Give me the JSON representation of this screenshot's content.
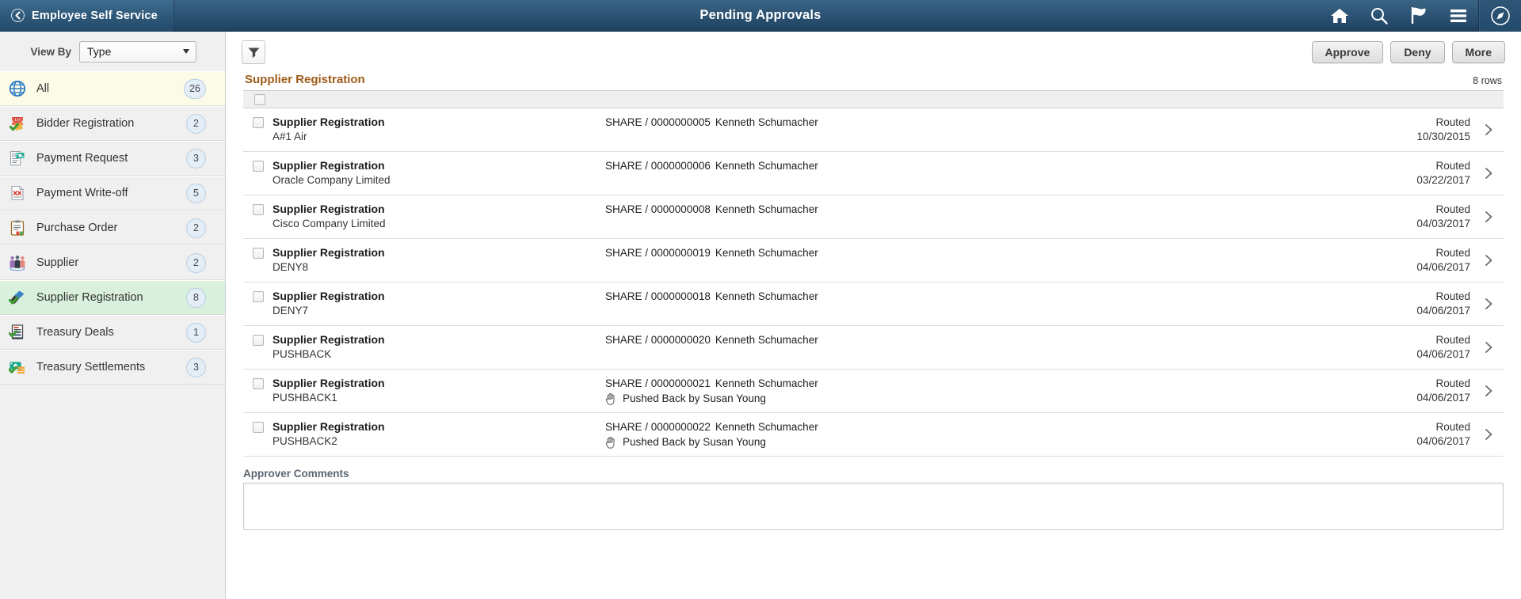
{
  "header": {
    "back_label": "Employee Self Service",
    "title": "Pending Approvals",
    "icons": {
      "home": "home-icon",
      "search": "search-icon",
      "notifications": "flag-icon",
      "actions": "hamburger-menu-icon",
      "navbar": "navbar-compass-icon"
    }
  },
  "sidebar": {
    "view_by_label": "View By",
    "view_by_value": "Type",
    "view_by_options": [
      "Type"
    ],
    "items": [
      {
        "label": "All",
        "count": "26",
        "icon": "globe-icon",
        "state": "highlighted"
      },
      {
        "label": "Bidder Registration",
        "count": "2",
        "icon": "bidder-registration-icon",
        "state": "normal"
      },
      {
        "label": "Payment Request",
        "count": "3",
        "icon": "payment-request-icon",
        "state": "normal"
      },
      {
        "label": "Payment Write-off",
        "count": "5",
        "icon": "payment-writeoff-icon",
        "state": "normal"
      },
      {
        "label": "Purchase Order",
        "count": "2",
        "icon": "purchase-order-icon",
        "state": "normal"
      },
      {
        "label": "Supplier",
        "count": "2",
        "icon": "supplier-icon",
        "state": "normal"
      },
      {
        "label": "Supplier Registration",
        "count": "8",
        "icon": "supplier-registration-icon",
        "state": "selected"
      },
      {
        "label": "Treasury Deals",
        "count": "1",
        "icon": "treasury-deals-icon",
        "state": "normal"
      },
      {
        "label": "Treasury Settlements",
        "count": "3",
        "icon": "treasury-settlements-icon",
        "state": "normal"
      }
    ]
  },
  "toolbar": {
    "filter_icon": "filter-funnel-icon",
    "approve_label": "Approve",
    "deny_label": "Deny",
    "more_label": "More"
  },
  "grid": {
    "title": "Supplier Registration",
    "row_count_label": "8 rows",
    "rows": [
      {
        "title": "Supplier Registration",
        "description": "A#1 Air",
        "source": "SHARE / 0000000005",
        "requester": "Kenneth Schumacher",
        "pushback": "",
        "status": "Routed",
        "date": "10/30/2015"
      },
      {
        "title": "Supplier Registration",
        "description": "Oracle Company Limited",
        "source": "SHARE / 0000000006",
        "requester": "Kenneth Schumacher",
        "pushback": "",
        "status": "Routed",
        "date": "03/22/2017"
      },
      {
        "title": "Supplier Registration",
        "description": "Cisco Company Limited",
        "source": "SHARE / 0000000008",
        "requester": "Kenneth Schumacher",
        "pushback": "",
        "status": "Routed",
        "date": "04/03/2017"
      },
      {
        "title": "Supplier Registration",
        "description": "DENY8",
        "source": "SHARE / 0000000019",
        "requester": "Kenneth Schumacher",
        "pushback": "",
        "status": "Routed",
        "date": "04/06/2017"
      },
      {
        "title": "Supplier Registration",
        "description": "DENY7",
        "source": "SHARE / 0000000018",
        "requester": "Kenneth Schumacher",
        "pushback": "",
        "status": "Routed",
        "date": "04/06/2017"
      },
      {
        "title": "Supplier Registration",
        "description": "PUSHBACK",
        "source": "SHARE / 0000000020",
        "requester": "Kenneth Schumacher",
        "pushback": "",
        "status": "Routed",
        "date": "04/06/2017"
      },
      {
        "title": "Supplier Registration",
        "description": "PUSHBACK1",
        "source": "SHARE / 0000000021",
        "requester": "Kenneth Schumacher",
        "pushback": "Pushed Back by Susan Young",
        "status": "Routed",
        "date": "04/06/2017"
      },
      {
        "title": "Supplier Registration",
        "description": "PUSHBACK2",
        "source": "SHARE / 0000000022",
        "requester": "Kenneth Schumacher",
        "pushback": "Pushed Back by Susan Young",
        "status": "Routed",
        "date": "04/06/2017"
      }
    ]
  },
  "comments": {
    "label": "Approver Comments",
    "value": "",
    "placeholder": ""
  },
  "colors": {
    "header_blue": "#2e5575",
    "grid_title_orange": "#9e5b18",
    "selected_green": "#d8f0dc",
    "highlight_yellow": "#fcfbe8"
  }
}
